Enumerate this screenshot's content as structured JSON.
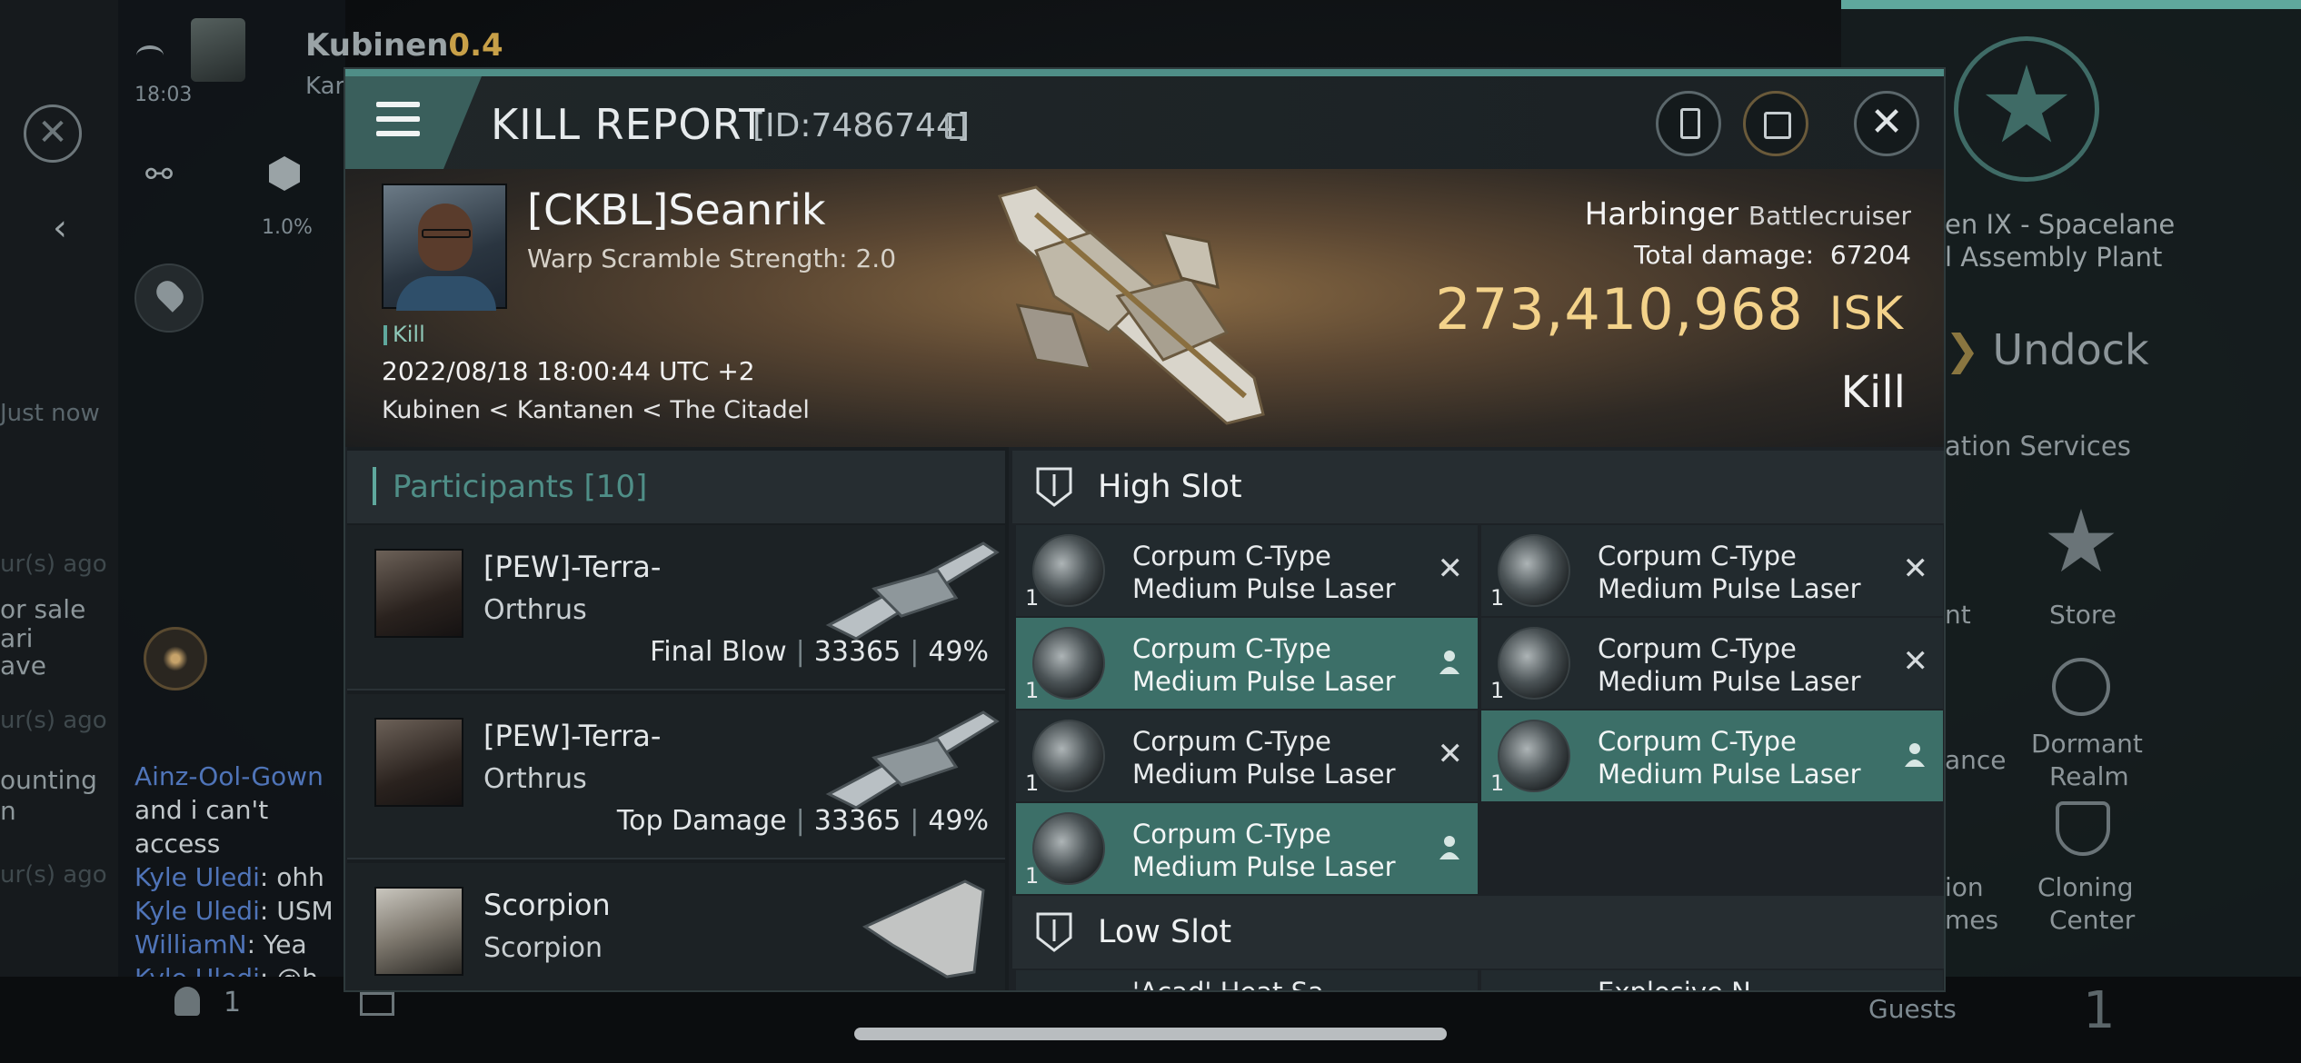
{
  "background": {
    "player_name": "Kubinen",
    "security": "0.4",
    "player_sub": "Kar",
    "time": "18:03",
    "cargo_pct": "1.0%",
    "chat_just_now": "Just now",
    "chat_hours_ago_1": "ur(s) ago",
    "chat_hours_ago_2": "ur(s) ago",
    "chat_hours_ago_3": "ur(s) ago",
    "chat_partial_1": "or sale",
    "chat_partial_2": "ari",
    "chat_partial_3": "ave",
    "chat_partial_4": "ounting",
    "chat_partial_5": "n",
    "chat_lines": [
      {
        "name": "Ainz-Ool-Gown",
        "text": ""
      },
      {
        "name": "",
        "text": "and i can't access"
      },
      {
        "name": "Kyle Uledi",
        "text": ": ohh"
      },
      {
        "name": "Kyle Uledi",
        "text": ": USM"
      },
      {
        "name": "WilliamN",
        "text": ": Yea"
      },
      {
        "name": "Kyle Uledi",
        "text": ": @h"
      }
    ],
    "station_name_1": "en IX - Spacelane",
    "station_name_2": "l Assembly Plant",
    "undock": "Undock",
    "station_services": "ation Services",
    "service_nt": "nt",
    "service_store": "Store",
    "service_ance": "ance",
    "service_dormant_1": "Dormant",
    "service_dormant_2": "Realm",
    "service_ion": "ion",
    "service_mes": "mes",
    "service_cloning_1": "Cloning",
    "service_cloning_2": "Center",
    "guests_label": "Guests",
    "guests_count": "1",
    "bottom_count": "1"
  },
  "header": {
    "title": "KILL REPORT",
    "id_text": "[ID:7486744]"
  },
  "victim": {
    "name": "[CKBL]Seanrik",
    "warp_scramble": "Warp Scramble Strength: 2.0",
    "tag": "Kill",
    "date": "2022/08/18 18:00:44 UTC +2",
    "location": "Kubinen < Kantanen < The Citadel",
    "ship_name": "Harbinger",
    "ship_class": "Battlecruiser",
    "total_damage_label": "Total damage:",
    "total_damage": "67204",
    "isk_value": "273,410,968",
    "isk_unit": "ISK",
    "result": "Kill"
  },
  "participants": {
    "label": "Participants",
    "count": "[10]",
    "rows": [
      {
        "name": "[PEW]-Terra-",
        "ship": "Orthrus",
        "tag": "Final Blow",
        "damage": "33365",
        "pct": "49%"
      },
      {
        "name": "[PEW]-Terra-",
        "ship": "Orthrus",
        "tag": "Top Damage",
        "damage": "33365",
        "pct": "49%"
      },
      {
        "name": "Scorpion",
        "ship": "Scorpion",
        "tag": "",
        "damage": "",
        "pct": ""
      }
    ]
  },
  "slots": {
    "high_label": "High Slot",
    "low_label": "Low Slot",
    "high": [
      {
        "line1": "Corpum C-Type",
        "line2": "Medium Pulse Laser",
        "qty": "1",
        "status": "destroyed"
      },
      {
        "line1": "Corpum C-Type",
        "line2": "Medium Pulse Laser",
        "qty": "1",
        "status": "destroyed"
      },
      {
        "line1": "Corpum C-Type",
        "line2": "Medium Pulse Laser",
        "qty": "1",
        "status": "dropped"
      },
      {
        "line1": "Corpum C-Type",
        "line2": "Medium Pulse Laser",
        "qty": "1",
        "status": "destroyed"
      },
      {
        "line1": "Corpum C-Type",
        "line2": "Medium Pulse Laser",
        "qty": "1",
        "status": "destroyed"
      },
      {
        "line1": "Corpum C-Type",
        "line2": "Medium Pulse Laser",
        "qty": "1",
        "status": "dropped"
      },
      {
        "line1": "Corpum C-Type",
        "line2": "Medium Pulse Laser",
        "qty": "1",
        "status": "dropped"
      }
    ],
    "low_partial": [
      "'Acad' Heat Sa",
      "Explosive N"
    ]
  },
  "colors": {
    "accent": "#5fa89d",
    "isk": "#f3d28a",
    "active_slot": "#3c6f68"
  }
}
